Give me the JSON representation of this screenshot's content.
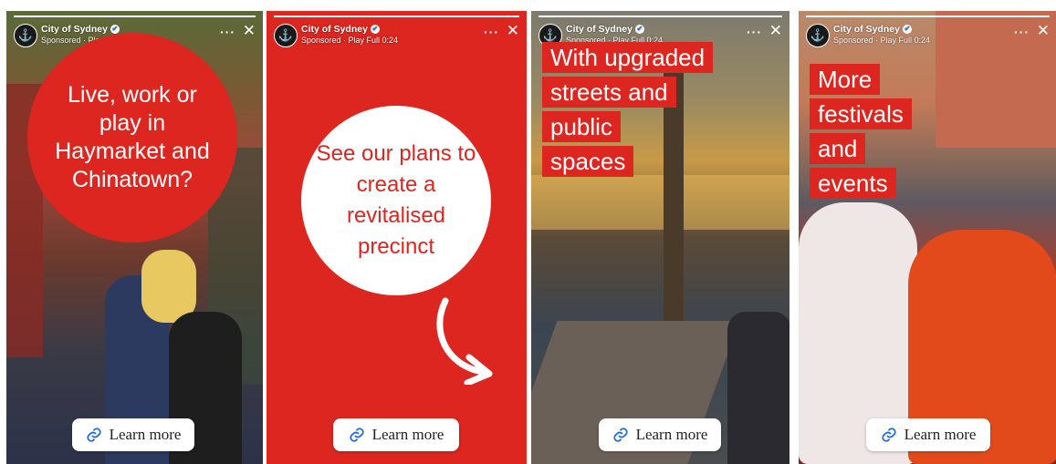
{
  "account": {
    "name": "City of Sydney",
    "subtitle": "Sponsored · Play Full 0:24",
    "logo_glyph": "⚓",
    "verified_glyph": "✔",
    "more_glyph": "···",
    "close_glyph": "✕"
  },
  "colors": {
    "brand_red": "#dc261f"
  },
  "stories": [
    {
      "text": "Live, work or play in Haymarket and Chinatown?",
      "button": "Learn more"
    },
    {
      "text": "See our plans to create a revitalised precinct",
      "button": "Learn more"
    },
    {
      "lines": [
        "With upgraded",
        "streets and",
        "public",
        "spaces"
      ],
      "button": "Learn more"
    },
    {
      "lines": [
        "More",
        "festivals",
        "and",
        "events"
      ],
      "button": "Learn more"
    }
  ]
}
